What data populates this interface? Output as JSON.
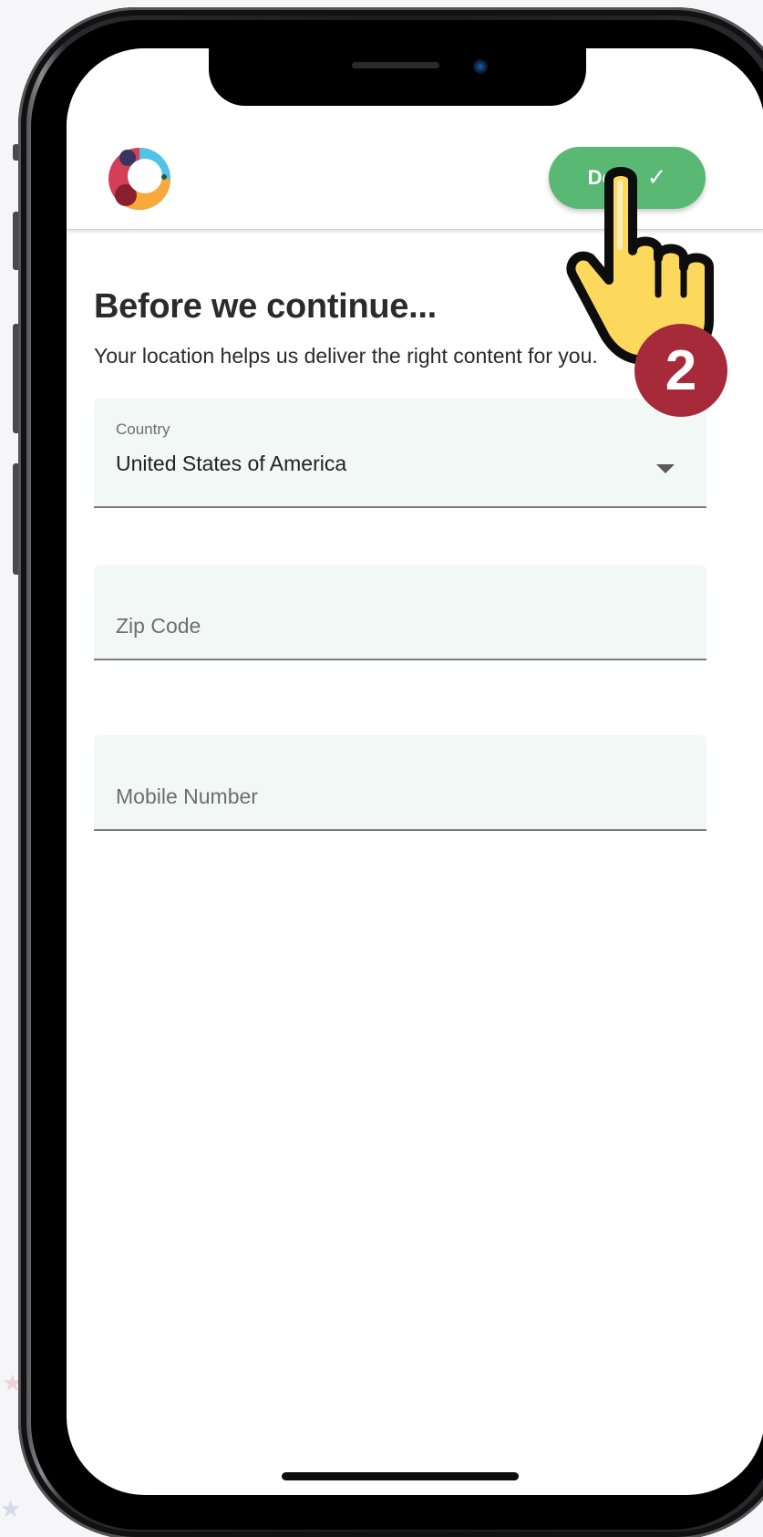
{
  "header": {
    "logo_name": "app-logo",
    "done_label": "Done",
    "done_icon": "checkmark-icon"
  },
  "content": {
    "title": "Before we continue...",
    "subtitle": "Your location helps us deliver the right content for you."
  },
  "form": {
    "country": {
      "label": "Country",
      "value": "United States of America",
      "icon": "dropdown-arrow-icon"
    },
    "zip": {
      "placeholder": "Zip Code"
    },
    "mobile": {
      "placeholder": "Mobile Number"
    }
  },
  "overlay": {
    "hand_icon": "pointing-hand-icon",
    "step_number": "2"
  },
  "colors": {
    "accent_green": "#59b873",
    "field_background": "#f2f8f6",
    "badge_red": "#a62a39",
    "hand_yellow": "#fcd95c",
    "logo_red": "#d33e58",
    "logo_blue": "#4ec4e8",
    "logo_orange": "#f7a93b",
    "logo_navy": "#3a3560",
    "logo_maroon": "#8a1f2e"
  }
}
